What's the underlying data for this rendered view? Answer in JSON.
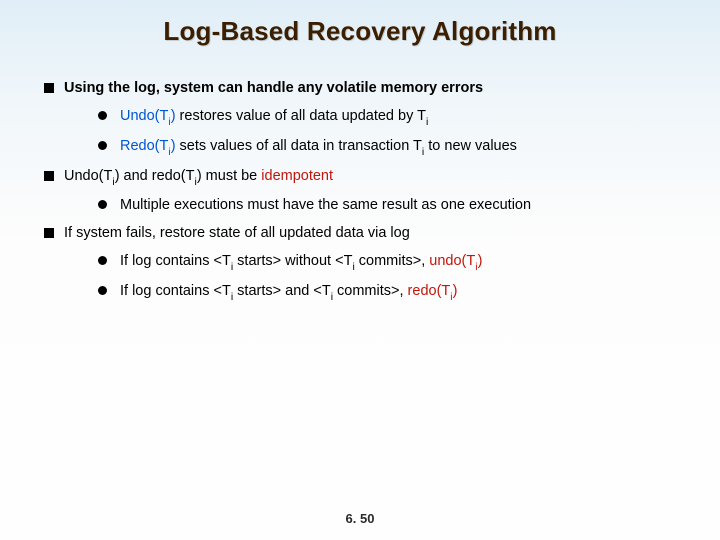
{
  "title": "Log-Based Recovery Algorithm",
  "bullet1": "Using the log, system can handle any volatile memory errors",
  "b1s1_a": "Undo(T",
  "b1s1_b": ")",
  "b1s1_c": " restores value of all data updated by T",
  "b1s2_a": "Redo(T",
  "b1s2_b": ")",
  "b1s2_c": " sets values of all data in transaction T",
  "b1s2_d": " to new values",
  "b2_a": "Undo(T",
  "b2_b": ") and redo(T",
  "b2_c": ") must be ",
  "b2_d": "idempotent",
  "b2s1": "Multiple executions must have the same result as one execution",
  "b3": "If system fails, restore state of all updated data via log",
  "b3s1_a": "If log contains <T",
  "b3s1_b": " starts> without <T",
  "b3s1_c": " commits>, ",
  "b3s1_d": "undo(T",
  "b3s1_e": ")",
  "b3s2_a": "If log contains <T",
  "b3s2_b": " starts> and <T",
  "b3s2_c": " commits>, ",
  "b3s2_d": "redo(T",
  "b3s2_e": ")",
  "sub_i": "i",
  "footer": "6. 50"
}
